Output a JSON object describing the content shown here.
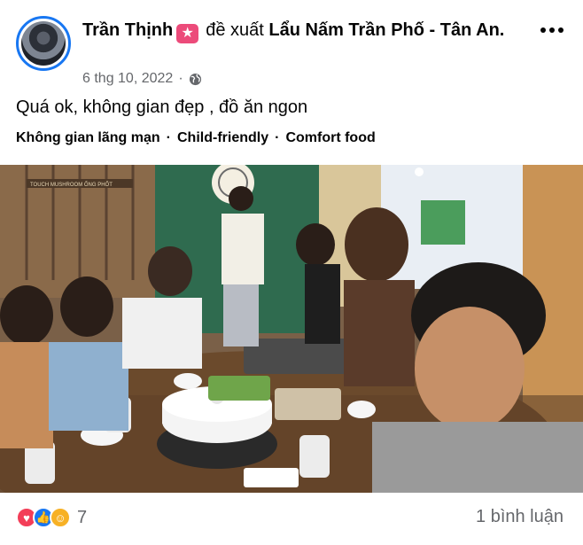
{
  "post": {
    "author": "Trần Thịnh",
    "badge_icon": "star-badge-icon",
    "verb": "đề xuất",
    "place": "Lẩu Nấm Trần Phố - Tân An.",
    "date": "6 thg 10, 2022",
    "separator": "·",
    "privacy_icon": "globe-icon",
    "text": "Quá ok, không gian đẹp , đồ ăn ngon",
    "tags": [
      "Không gian lãng mạn",
      "Child-friendly",
      "Comfort food"
    ],
    "tag_separator": "·",
    "photo_sign": "TOUCH MUSHROOM ỐNG PHỐT"
  },
  "footer": {
    "reaction_icons": [
      "love-icon",
      "like-icon",
      "care-icon"
    ],
    "reaction_count": "7",
    "comments": "1 bình luận"
  },
  "colors": {
    "brand": "#1877f2",
    "badge": "#ec4b7a",
    "secondary_text": "#65676b"
  }
}
